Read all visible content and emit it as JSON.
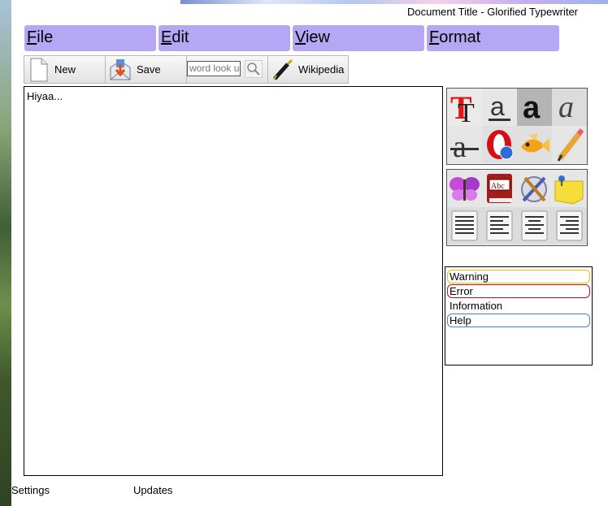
{
  "window": {
    "title": "Document Title - Glorified Typewriter"
  },
  "menu": [
    {
      "accel": "F",
      "rest": "ile"
    },
    {
      "accel": "E",
      "rest": "dit"
    },
    {
      "accel": "V",
      "rest": "iew"
    },
    {
      "accel": "F",
      "rest": "ormat"
    }
  ],
  "toolbar": {
    "new_label": "New",
    "save_label": "Save",
    "search_placeholder": "word look u",
    "wikipedia_label": "Wikipedia"
  },
  "editor": {
    "content": "Hiyaa..."
  },
  "format_icons": [
    "text-shadow-icon",
    "underline-icon",
    "bold-icon",
    "italic-icon",
    "strikethrough-icon",
    "opera-icon",
    "fish-icon",
    "pencil-icon"
  ],
  "tool_icons": [
    "butterfly-icon",
    "dictionary-icon",
    "tools-icon",
    "sticky-note-icon",
    "align-justify-icon",
    "align-left-icon",
    "align-center-icon",
    "align-right-icon"
  ],
  "messages": {
    "warning": "Warning",
    "error": "Error",
    "information": "Information",
    "help": "Help"
  },
  "colors": {
    "menu_bg": "#b6a7f5",
    "warning": "#f0c000",
    "error": "#d01010",
    "help": "#4a7fdc"
  },
  "footer": {
    "settings": "Settings",
    "updates": "Updates"
  }
}
